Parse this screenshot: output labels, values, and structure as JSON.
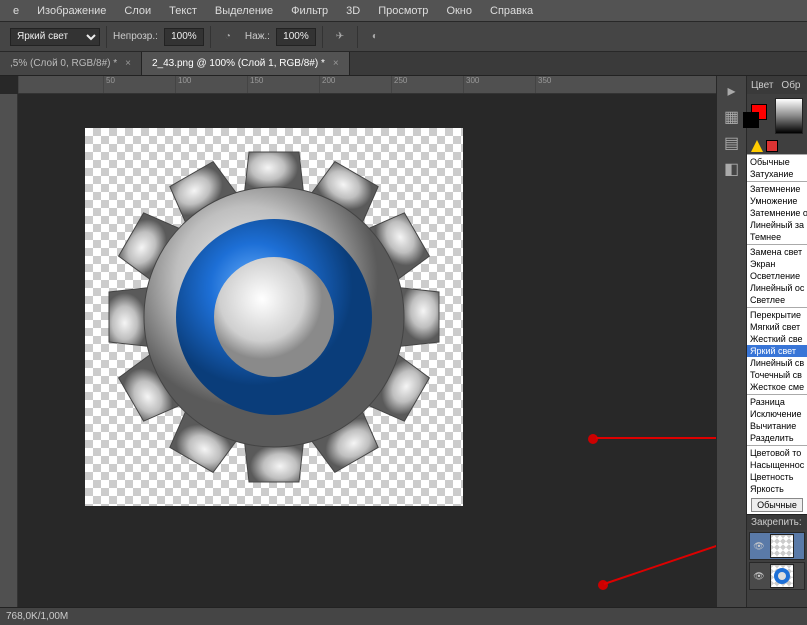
{
  "menu": [
    "е",
    "Изображение",
    "Слои",
    "Текст",
    "Выделение",
    "Фильтр",
    "3D",
    "Просмотр",
    "Окно",
    "Справка"
  ],
  "options": {
    "blend_label": "",
    "blend_value": "Яркий свет",
    "opacity_label": "Непрозр.:",
    "opacity_value": "100%",
    "flow_label": "Наж.:",
    "flow_value": "100%"
  },
  "tabs": [
    {
      "label": ",5% (Слой 0, RGB/8#) *",
      "active": false
    },
    {
      "label": "2_43.png @ 100% (Слой 1, RGB/8#) *",
      "active": true
    }
  ],
  "ruler_marks": [
    "50",
    "100",
    "150",
    "200",
    "250",
    "300",
    "350"
  ],
  "panels": {
    "color_tab": "Цвет",
    "props_tab": "Обр"
  },
  "blend_modes": {
    "groups": [
      [
        "Обычные",
        "Затухание"
      ],
      [
        "Затемнение",
        "Умножение",
        "Затемнение о",
        "Линейный за",
        "Темнее"
      ],
      [
        "Замена свет",
        "Экран",
        "Осветление",
        "Линейный ос",
        "Светлее"
      ],
      [
        "Перекрытие",
        "Мягкий свет",
        "Жесткий све",
        "Яркий свет",
        "Линейный св",
        "Точечный св",
        "Жесткое сме"
      ],
      [
        "Разница",
        "Исключение",
        "Вычитание",
        "Разделить"
      ],
      [
        "Цветовой то",
        "Насыщеннос",
        "Цветность",
        "Яркость"
      ]
    ],
    "highlight": "Яркий свет",
    "normal_btn": "Обычные"
  },
  "lock_label": "Закрепить:",
  "status": "768,0K/1,00M"
}
